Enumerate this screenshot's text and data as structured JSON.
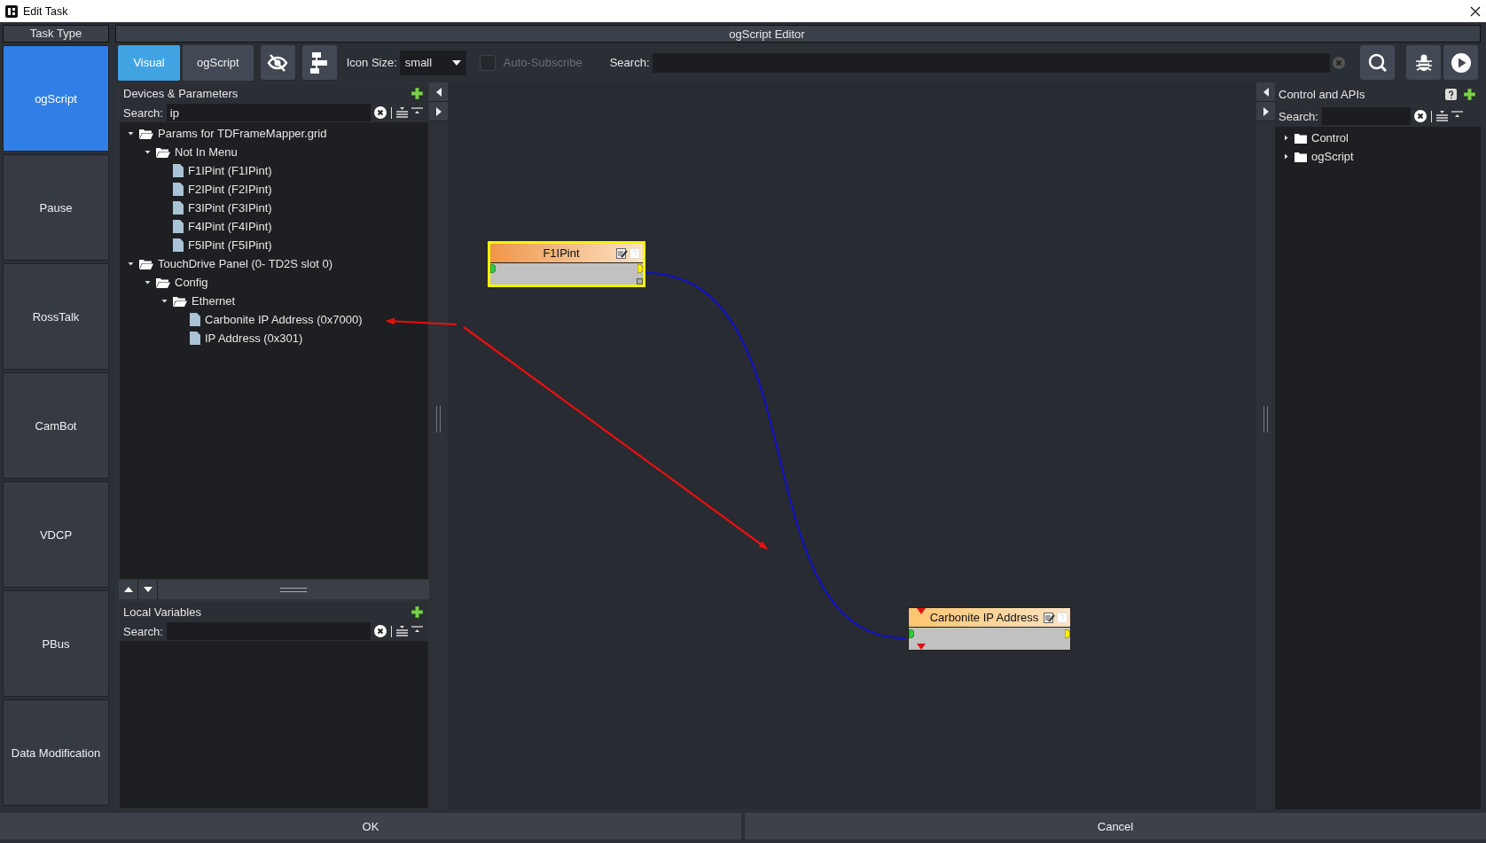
{
  "window": {
    "title": "Edit Task"
  },
  "task_type": {
    "title": "Task Type",
    "items": [
      {
        "label": "ogScript",
        "selected": true
      },
      {
        "label": "Pause",
        "selected": false
      },
      {
        "label": "RossTalk",
        "selected": false
      },
      {
        "label": "CamBot",
        "selected": false
      },
      {
        "label": "VDCP",
        "selected": false
      },
      {
        "label": "PBus",
        "selected": false
      },
      {
        "label": "Data Modification",
        "selected": false
      }
    ]
  },
  "editor": {
    "title": "ogScript Editor",
    "view_tabs": [
      {
        "label": "Visual",
        "selected": true
      },
      {
        "label": "ogScript",
        "selected": false
      }
    ],
    "icon_size": {
      "label": "Icon Size:",
      "value": "small"
    },
    "auto_subscribe": {
      "label": "Auto-Subscribe",
      "checked": false,
      "disabled": true
    },
    "search": {
      "label": "Search:"
    }
  },
  "devices": {
    "title": "Devices & Parameters",
    "search_label": "Search:",
    "search_value": "ip",
    "tree": [
      {
        "kind": "folder",
        "label": "Params for TDFrameMapper.grid",
        "expanded": true,
        "children": [
          {
            "kind": "folder",
            "label": "Not In Menu",
            "expanded": true,
            "children": [
              {
                "kind": "param",
                "label": "F1IPint (F1IPint)"
              },
              {
                "kind": "param",
                "label": "F2IPint (F2IPint)"
              },
              {
                "kind": "param",
                "label": "F3IPint (F3IPint)"
              },
              {
                "kind": "param",
                "label": "F4IPint (F4IPint)"
              },
              {
                "kind": "param",
                "label": "F5IPint (F5IPint)"
              }
            ]
          }
        ]
      },
      {
        "kind": "folder",
        "label": "TouchDrive Panel (0- TD2S slot 0)",
        "expanded": true,
        "children": [
          {
            "kind": "folder",
            "label": "Config",
            "expanded": true,
            "children": [
              {
                "kind": "folder",
                "label": "Ethernet",
                "expanded": true,
                "children": [
                  {
                    "kind": "param",
                    "label": "Carbonite IP Address (0x7000)"
                  },
                  {
                    "kind": "param",
                    "label": "IP Address (0x301)"
                  }
                ]
              }
            ]
          }
        ]
      }
    ]
  },
  "local_variables": {
    "title": "Local Variables",
    "search_label": "Search:"
  },
  "canvas": {
    "nodes": [
      {
        "title": "F1IPint",
        "color": "#f0954a",
        "selected": true
      },
      {
        "title": "Carbonite IP Address",
        "color": "#fcc56e",
        "selected": false
      }
    ]
  },
  "control_apis": {
    "title": "Control and APIs",
    "search_label": "Search:",
    "tree": [
      {
        "kind": "folder",
        "label": "Control",
        "expanded": false
      },
      {
        "kind": "folder",
        "label": "ogScript",
        "expanded": false
      }
    ]
  },
  "buttons": [
    "OK",
    "Cancel"
  ]
}
